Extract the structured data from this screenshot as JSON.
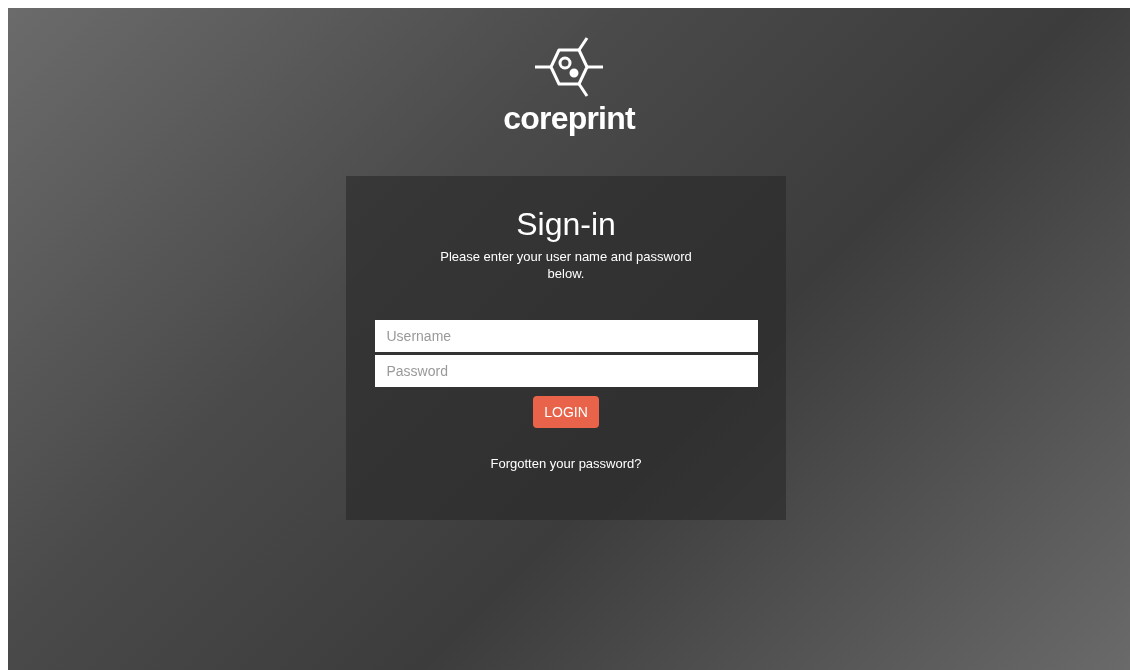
{
  "logo": {
    "text": "coreprint"
  },
  "signin": {
    "title": "Sign-in",
    "subtitle": "Please enter your user name and password below.",
    "username": {
      "placeholder": "Username"
    },
    "password": {
      "placeholder": "Password"
    },
    "button": "LOGIN",
    "forgot_link": "Forgotten your password?"
  }
}
